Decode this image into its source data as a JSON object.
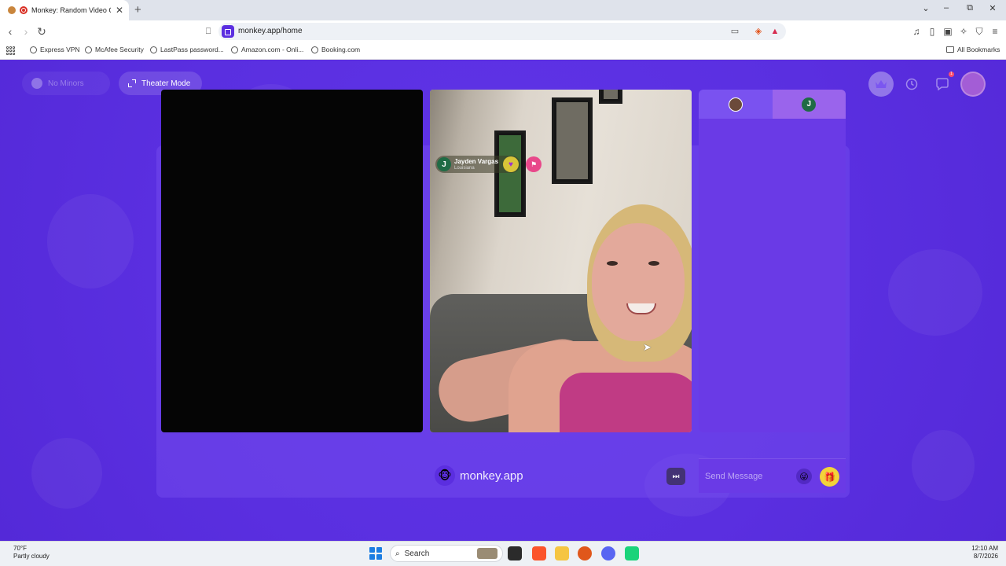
{
  "browser": {
    "tab": {
      "title": "Monkey: Random Video Chat",
      "close": "✕"
    },
    "new_tab": "+",
    "window_controls": {
      "tab_list": "⌄",
      "minimize": "–",
      "restore": "⧉",
      "close": "✕"
    },
    "url": "monkey.app/home",
    "bookmarks": [
      {
        "label": "Express VPN"
      },
      {
        "label": "McAfee Security"
      },
      {
        "label": "LastPass password..."
      },
      {
        "label": "Amazon.com - Onli..."
      },
      {
        "label": "Booking.com"
      }
    ],
    "all_bookmarks": "All Bookmarks"
  },
  "page": {
    "no_minors_label": "No Minors",
    "theater_mode_label": "Theater Mode",
    "notification_count": "1",
    "remote_user": {
      "initial": "J",
      "name": "Jayden Vargas",
      "location": "Louisiana"
    },
    "watermark": "monkey.app",
    "chat": {
      "tab2_initial": "J",
      "input_placeholder": "Send Message"
    }
  },
  "taskbar": {
    "weather_temp": "70°F",
    "weather_desc": "Partly cloudy",
    "search_label": "Search",
    "time": "12:10 AM",
    "date": "8/7/2026"
  },
  "colors": {
    "brand_purple": "#5b2ee0",
    "gift_yellow": "#f2d33a",
    "report_pink": "#e8488a"
  }
}
